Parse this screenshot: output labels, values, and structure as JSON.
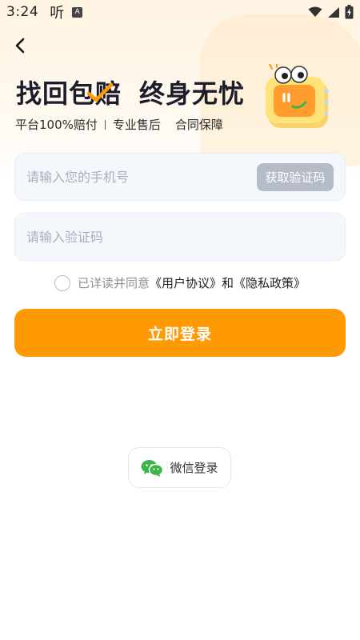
{
  "status_bar": {
    "time": "3:24",
    "app_glyph": "听",
    "badge": "A",
    "icons": [
      "wifi-icon",
      "signal-icon",
      "battery-charging-icon"
    ]
  },
  "nav": {
    "back_icon": "chevron-left-icon"
  },
  "hero": {
    "title_part1": "找回包赔",
    "title_part2": "终身无忧",
    "feature1": "平台100%赔付",
    "feature2": "专业售后",
    "feature3": "合同保障",
    "accent_color": "#ff9a05"
  },
  "form": {
    "phone_placeholder": "请输入您的手机号",
    "phone_value": "",
    "get_code_label": "获取验证码",
    "code_placeholder": "请输入验证码",
    "code_value": ""
  },
  "agreement": {
    "prefix": "已详读并同意",
    "user_agreement": "《用户协议》",
    "and": "和",
    "privacy_policy": "《隐私政策》",
    "checked": false
  },
  "login_button": "立即登录",
  "wechat_login": {
    "label": "微信登录",
    "icon": "wechat-icon",
    "icon_color": "#3bb44a"
  }
}
